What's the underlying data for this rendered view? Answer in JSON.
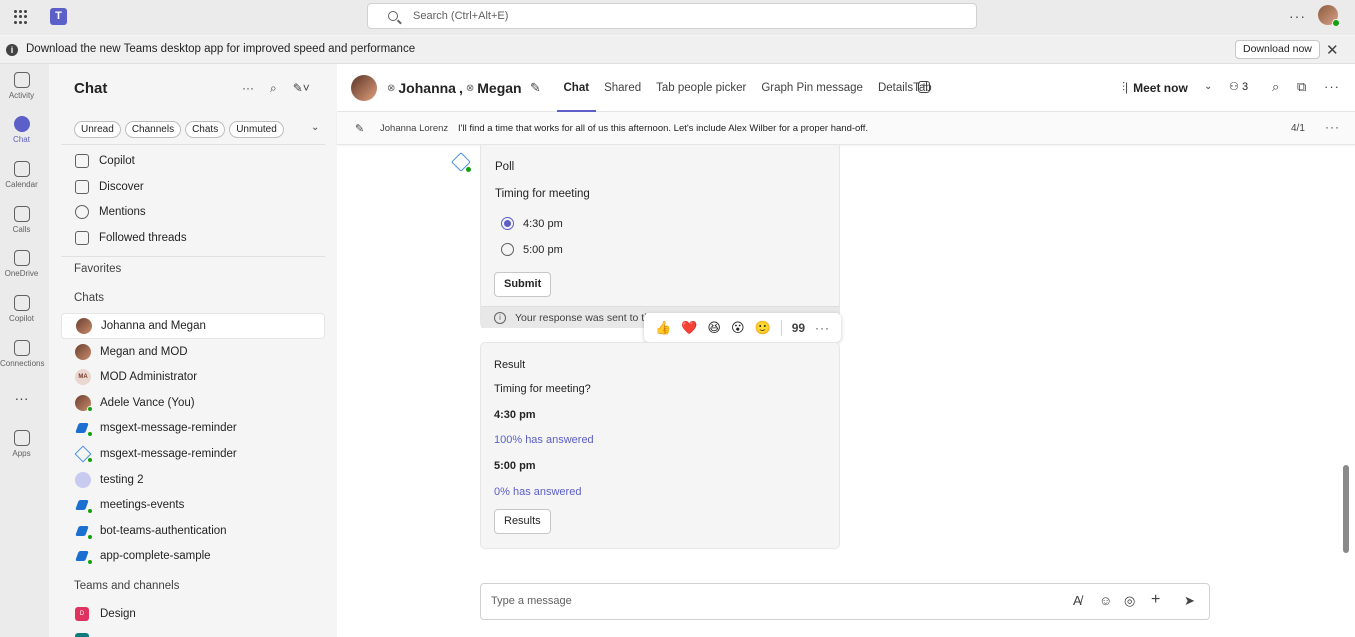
{
  "titlebar": {
    "search_placeholder": "Search (Ctrl+Alt+E)",
    "more": "···"
  },
  "banner": {
    "text": "Download the new Teams desktop app for improved speed and performance",
    "download": "Download now",
    "close": "✕"
  },
  "rail": [
    {
      "label": "Activity",
      "icon": "bell-icon"
    },
    {
      "label": "Chat",
      "icon": "chat-icon"
    },
    {
      "label": "Calendar",
      "icon": "calendar-icon"
    },
    {
      "label": "Calls",
      "icon": "phone-icon"
    },
    {
      "label": "OneDrive",
      "icon": "cloud-icon"
    },
    {
      "label": "Copilot",
      "icon": "copilot-icon"
    },
    {
      "label": "Connections",
      "icon": "connections-icon"
    },
    {
      "label": "···",
      "icon": "more-icon"
    },
    {
      "label": "Apps",
      "icon": "apps-icon"
    }
  ],
  "chatlist": {
    "title": "Chat",
    "filters": [
      "Unread",
      "Channels",
      "Chats",
      "Unmuted"
    ],
    "quick": [
      "Copilot",
      "Discover",
      "Mentions",
      "Followed threads"
    ],
    "favorites": "Favorites",
    "chats_header": "Chats",
    "chats": [
      "Johanna and Megan",
      "Megan and MOD",
      "MOD Administrator",
      "Adele Vance (You)",
      "msgext-message-reminder",
      "msgext-message-reminder",
      "testing 2",
      "meetings-events",
      "bot-teams-authentication",
      "app-complete-sample"
    ],
    "ma_initials": "MA",
    "teams_header": "Teams and channels",
    "teams": [
      "Design"
    ],
    "team_initial": "D"
  },
  "header": {
    "name1": "Johanna",
    "name2": "Megan",
    "tabs": [
      "Chat",
      "Shared",
      "Tab people picker",
      "Graph Pin message",
      "DetailsTab"
    ],
    "meet_now": "Meet now",
    "participants": "3"
  },
  "pinbar": {
    "author": "Johanna Lorenz",
    "message": "I'll find a time that works for all of us this afternoon. Let's include Alex Wilber for a proper hand-off.",
    "count": "4/1"
  },
  "poll": {
    "title": "Poll",
    "question": "Timing for meeting",
    "options": [
      "4:30 pm",
      "5:00 pm"
    ],
    "selected": 0,
    "submit": "Submit",
    "response": "Your response was sent to th"
  },
  "reactions": [
    "👍",
    "❤️",
    "😆",
    "😮",
    "🙂"
  ],
  "result": {
    "title": "Result",
    "question": "Timing for meeting?",
    "opt1": "4:30 pm",
    "opt1_pct": "100% has answered",
    "opt2": "5:00 pm",
    "opt2_pct": "0% has answered",
    "button": "Results"
  },
  "compose": {
    "placeholder": "Type a message"
  },
  "colors": {
    "accent": "#5b5fc7",
    "online": "#13a10e"
  }
}
